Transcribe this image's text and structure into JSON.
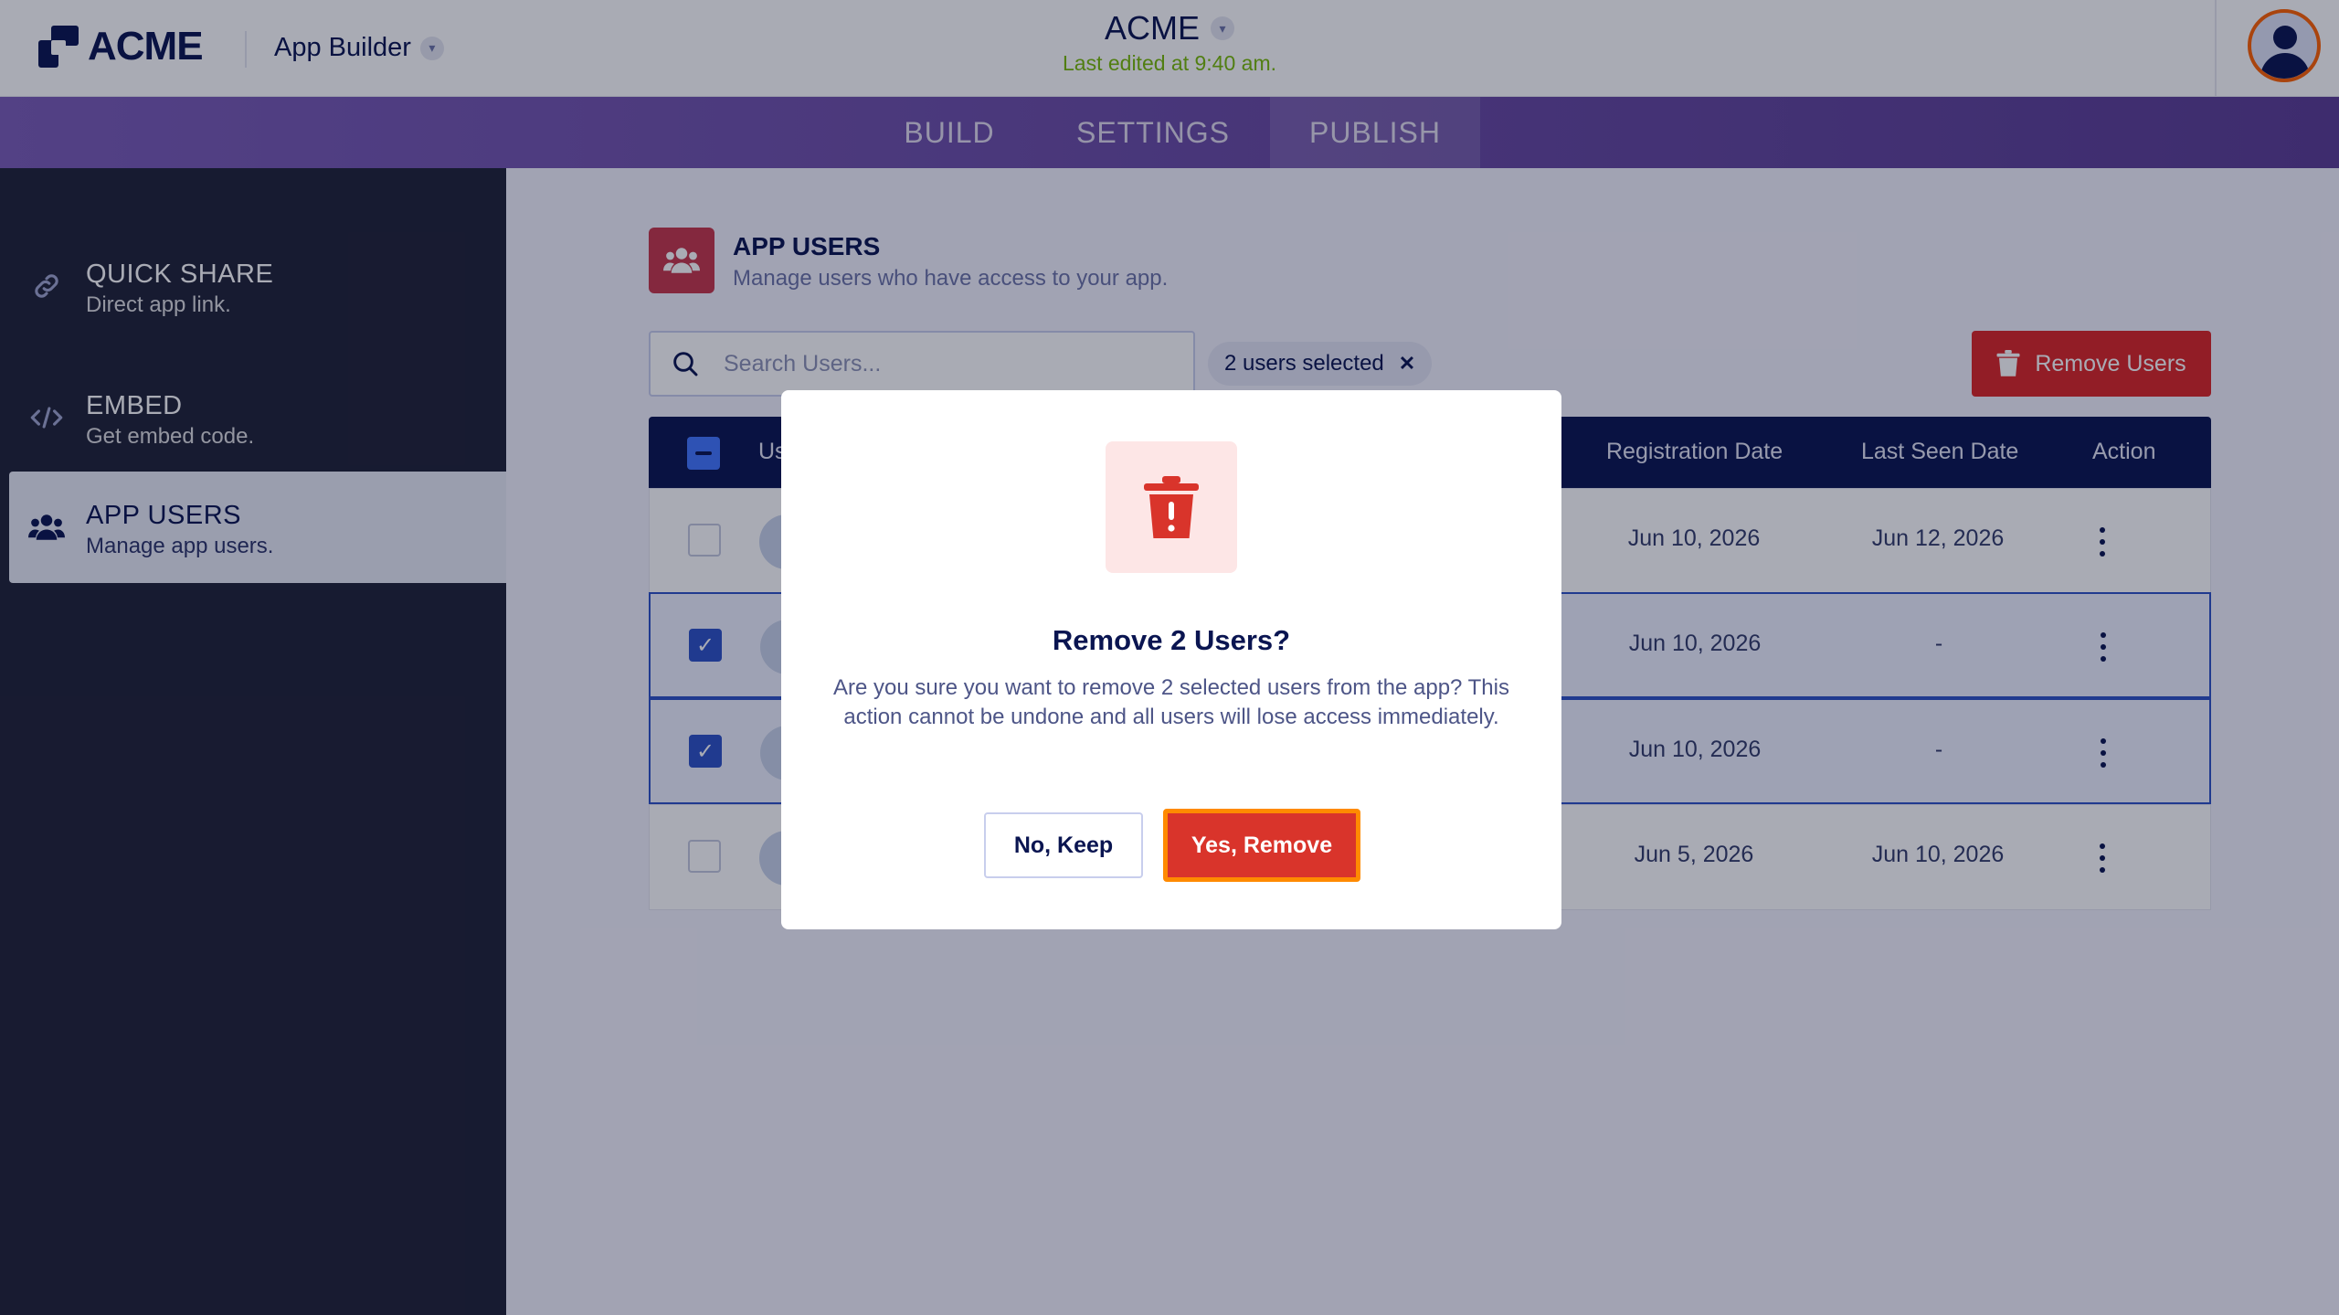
{
  "header": {
    "logo_text": "ACME",
    "app_builder_label": "App Builder",
    "form_title": "ACME",
    "last_edited": "Last edited at 9:40 am."
  },
  "nav": {
    "tabs": [
      {
        "label": "BUILD",
        "active": false
      },
      {
        "label": "SETTINGS",
        "active": false
      },
      {
        "label": "PUBLISH",
        "active": true
      }
    ]
  },
  "sidebar": {
    "items": [
      {
        "icon": "link-icon",
        "title": "QUICK SHARE",
        "subtitle": "Direct app link.",
        "active": false
      },
      {
        "icon": "code-icon",
        "title": "EMBED",
        "subtitle": "Get embed code.",
        "active": false
      },
      {
        "icon": "users-icon",
        "title": "APP USERS",
        "subtitle": "Manage app users.",
        "active": true
      }
    ]
  },
  "main": {
    "title": "APP USERS",
    "subtitle": "Manage users who have access to your app.",
    "search_placeholder": "Search Users...",
    "selection_chip": "2 users selected",
    "remove_users_label": "Remove Users",
    "table": {
      "columns": [
        "Us",
        "Registration Date",
        "Last Seen Date",
        "Action"
      ],
      "rows": [
        {
          "checked": false,
          "registration_date": "Jun 10, 2026",
          "last_seen_date": "Jun 12, 2026"
        },
        {
          "checked": true,
          "registration_date": "Jun 10, 2026",
          "last_seen_date": "-"
        },
        {
          "checked": true,
          "registration_date": "Jun 10, 2026",
          "last_seen_date": "-"
        },
        {
          "checked": false,
          "registration_date": "Jun 5, 2026",
          "last_seen_date": "Jun 10, 2026"
        }
      ]
    }
  },
  "modal": {
    "icon": "trash-alert-icon",
    "title": "Remove 2 Users?",
    "message": "Are you sure you want to remove 2 selected users from the app? This action cannot be undone and all users will lose access immediately.",
    "cancel_label": "No, Keep",
    "confirm_label": "Yes, Remove"
  },
  "colors": {
    "brand_navy": "#0a1551",
    "nav_purple": "#6f53a6",
    "danger": "#dc2626",
    "focus_ring": "#ff8a00",
    "success_text": "#78bb07"
  }
}
